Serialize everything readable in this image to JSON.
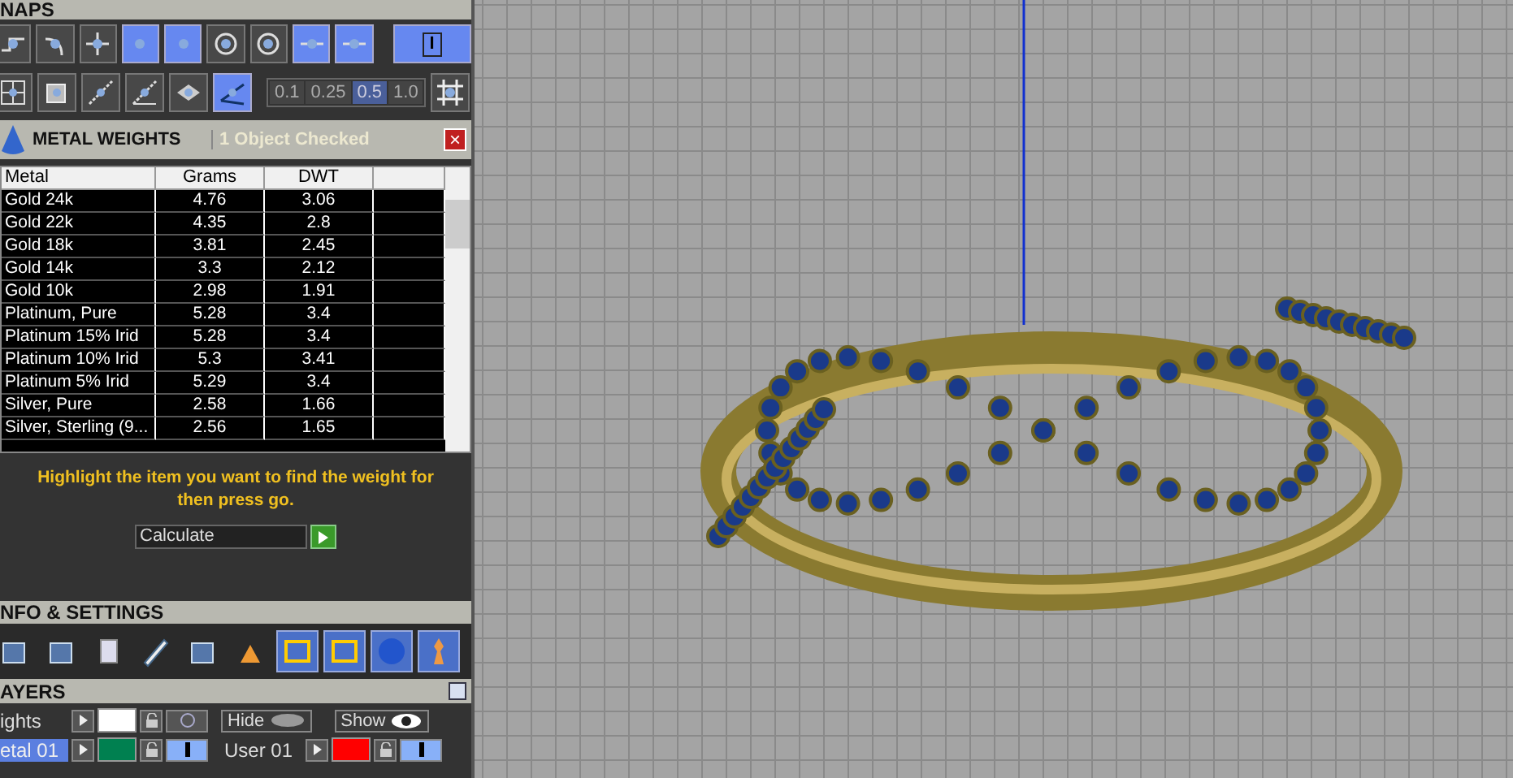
{
  "snaps": {
    "title": "NAPS",
    "tools_row1": [
      {
        "on": false
      },
      {
        "on": false
      },
      {
        "on": false
      },
      {
        "on": true
      },
      {
        "on": true
      },
      {
        "on": false
      },
      {
        "on": false
      },
      {
        "on": true
      },
      {
        "on": true
      }
    ],
    "mode_button": {
      "label": "I",
      "on": true
    },
    "tools_row2": [
      {
        "on": false
      },
      {
        "on": false
      },
      {
        "on": false
      },
      {
        "on": false
      },
      {
        "on": false
      },
      {
        "on": true
      }
    ],
    "steps": [
      {
        "label": "0.1",
        "selected": false
      },
      {
        "label": "0.25",
        "selected": false
      },
      {
        "label": "0.5",
        "selected": true
      },
      {
        "label": "1.0",
        "selected": false
      }
    ]
  },
  "metal_weights": {
    "title": "METAL WEIGHTS",
    "status": "1 Object Checked",
    "close": "×",
    "columns": [
      "Metal",
      "Grams",
      "DWT"
    ],
    "rows": [
      {
        "metal": "Gold 24k",
        "grams": "4.76",
        "dwt": "3.06"
      },
      {
        "metal": "Gold 22k",
        "grams": "4.35",
        "dwt": "2.8"
      },
      {
        "metal": "Gold 18k",
        "grams": "3.81",
        "dwt": "2.45"
      },
      {
        "metal": "Gold 14k",
        "grams": "3.3",
        "dwt": "2.12"
      },
      {
        "metal": "Gold 10k",
        "grams": "2.98",
        "dwt": "1.91"
      },
      {
        "metal": "Platinum, Pure",
        "grams": "5.28",
        "dwt": "3.4"
      },
      {
        "metal": "Platinum 15% Irid",
        "grams": "5.28",
        "dwt": "3.4"
      },
      {
        "metal": "Platinum 10% Irid",
        "grams": "5.3",
        "dwt": "3.41"
      },
      {
        "metal": "Platinum 5% Irid",
        "grams": "5.29",
        "dwt": "3.4"
      },
      {
        "metal": "Silver, Pure",
        "grams": "2.58",
        "dwt": "1.66"
      },
      {
        "metal": "Silver, Sterling (9...",
        "grams": "2.56",
        "dwt": "1.65"
      }
    ],
    "hint": "Highlight the item you want to find the weight for then press go.",
    "action": "Calculate"
  },
  "info_settings": {
    "title": "NFO & SETTINGS"
  },
  "layers": {
    "title": "AYERS",
    "left": [
      {
        "name": "ights",
        "color": "#ffffff",
        "visible": false
      },
      {
        "name": "etal 01",
        "color": "#008050",
        "visible": true
      }
    ],
    "hide": "Hide",
    "show": "Show",
    "right": [
      {
        "name": "User 01",
        "color": "#ff0000",
        "visible": true
      }
    ]
  }
}
